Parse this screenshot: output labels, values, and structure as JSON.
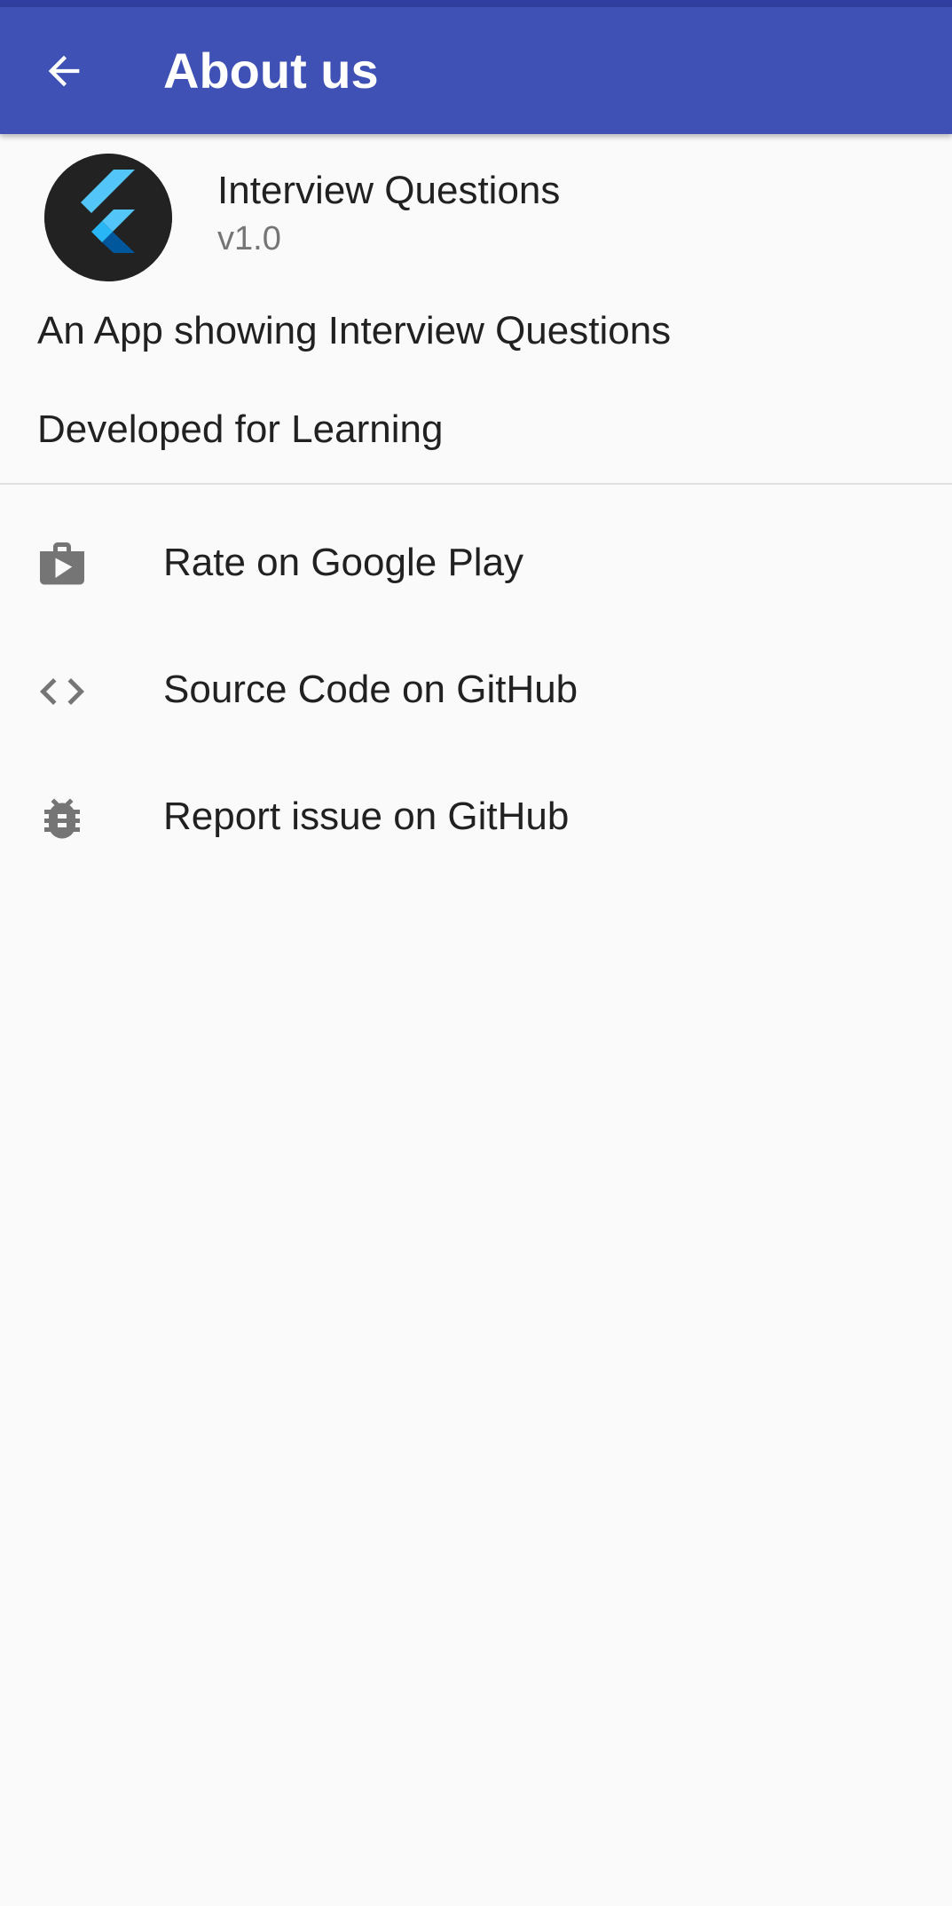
{
  "app_bar": {
    "title": "About us",
    "back_icon": "arrow-back-icon",
    "color": "#3f51b5",
    "status_bar_color": "#303f9f"
  },
  "app_info": {
    "logo_icon": "flutter-logo-icon",
    "name": "Interview Questions",
    "version": "v1.0",
    "description": "An App showing Interview Questions",
    "developed_note": "Developed for Learning"
  },
  "menu": {
    "items": [
      {
        "label": "Rate on Google Play",
        "icon": "google-play-shop-icon"
      },
      {
        "label": "Source Code on GitHub",
        "icon": "code-icon"
      },
      {
        "label": "Report issue on GitHub",
        "icon": "bug-icon"
      }
    ],
    "icon_color": "#757575"
  }
}
